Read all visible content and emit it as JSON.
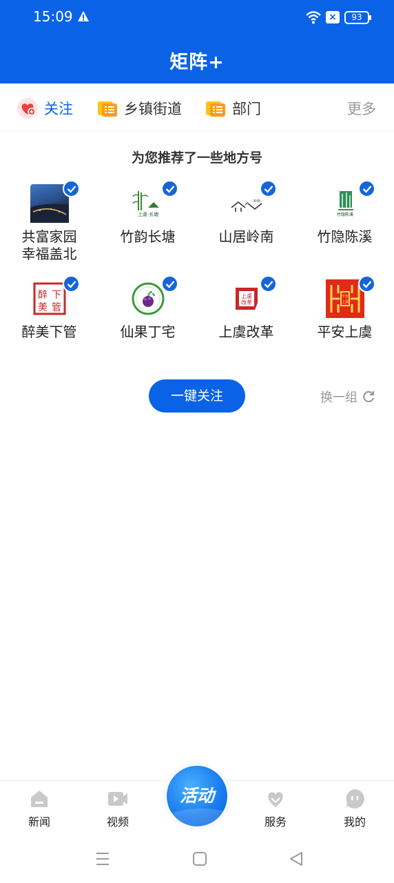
{
  "status_bar": {
    "time": "15:09",
    "battery": "93"
  },
  "header": {
    "title": "矩阵+"
  },
  "tabs": [
    {
      "label": "关注",
      "icon": "heart-plus-icon"
    },
    {
      "label": "乡镇街道",
      "icon": "list-doc-icon"
    },
    {
      "label": "部门",
      "icon": "list-doc-icon"
    }
  ],
  "tabs_more": "更多",
  "recommend": {
    "title": "为您推荐了一些地方号",
    "items": [
      {
        "name": "共富家园\n幸福盖北"
      },
      {
        "name": "竹韵长塘"
      },
      {
        "name": "山居岭南"
      },
      {
        "name": "竹隐陈溪"
      },
      {
        "name": "醉美下管"
      },
      {
        "name": "仙果丁宅"
      },
      {
        "name": "上虞改革"
      },
      {
        "name": "平安上虞"
      }
    ],
    "follow_all": "一键关注",
    "refresh": "换一组"
  },
  "bottom_nav": {
    "news": "新闻",
    "video": "视频",
    "activity": "活动",
    "service": "服务",
    "mine": "我的"
  },
  "colors": {
    "primary": "#0a63e6",
    "check": "#1565d8"
  }
}
